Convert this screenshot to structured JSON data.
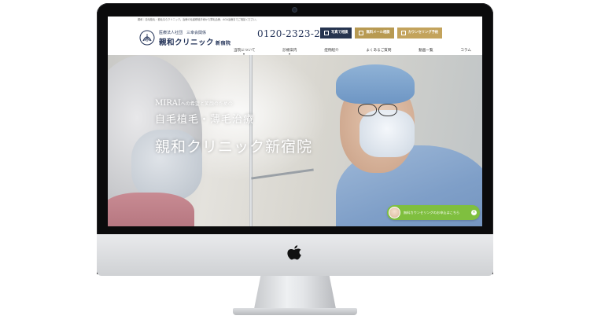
{
  "site": {
    "topline": "親和｜自毛植毛・植毛ならクリニック。治療の毛髪移植手術から薄毛治療、AGA治療までご相談ください。",
    "brand": {
      "sub": "医療法人社団　三幸会関係",
      "name": "親和クリニック",
      "branch": "新宿院"
    },
    "phone": "0120-2323-24",
    "buttons": [
      {
        "label": "写真で相談",
        "icon": "camera-icon"
      },
      {
        "label": "無料メール相談",
        "icon": "mail-icon"
      },
      {
        "label": "カウンセリング予約",
        "icon": "calendar-icon"
      }
    ],
    "nav": [
      {
        "label": "当院について",
        "has_caret": true
      },
      {
        "label": "診療案内",
        "has_caret": true
      },
      {
        "label": "症例紹介",
        "has_caret": false
      },
      {
        "label": "よくあるご質問",
        "has_caret": false
      },
      {
        "label": "動画一覧",
        "has_caret": false
      },
      {
        "label": "コラム",
        "has_caret": false
      }
    ]
  },
  "hero": {
    "line1_main": "MIRAI",
    "line1_small": "への希望と笑顔のための",
    "line2": "自毛植毛・薄毛治療",
    "line3": "親和クリニック新宿院"
  },
  "counsel_pill": {
    "text": "無料カウンセリングのお申込はこちら",
    "close": "×"
  },
  "colors": {
    "navy": "#26344f",
    "gold": "#b89a52",
    "green": "#7fbf3f"
  }
}
